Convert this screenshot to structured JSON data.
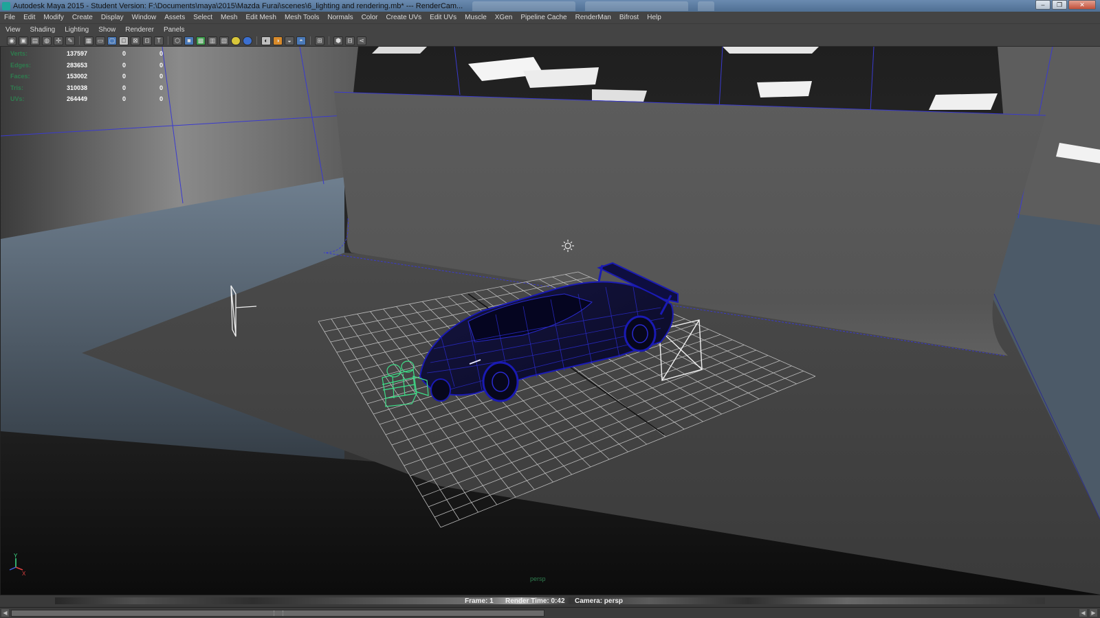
{
  "window": {
    "title": "Autodesk Maya 2015 - Student Version: F:\\Documents\\maya\\2015\\Mazda Furai\\scenes\\6_lighting and rendering.mb*   ---   RenderCam...",
    "controls": [
      "–",
      "❐",
      "✕"
    ]
  },
  "menubar": {
    "items": [
      "File",
      "Edit",
      "Modify",
      "Create",
      "Display",
      "Window",
      "Assets",
      "Select",
      "Mesh",
      "Edit Mesh",
      "Mesh Tools",
      "Normals",
      "Color",
      "Create UVs",
      "Edit UVs",
      "Muscle",
      "XGen",
      "Pipeline Cache",
      "RenderMan",
      "Bifrost",
      "Help"
    ]
  },
  "panel_menu": {
    "items": [
      "View",
      "Shading",
      "Lighting",
      "Show",
      "Renderer",
      "Panels"
    ]
  },
  "hud": {
    "rows": [
      {
        "label": "Verts:",
        "total": "137597",
        "selected": "0",
        "component": "0"
      },
      {
        "label": "Edges:",
        "total": "283653",
        "selected": "0",
        "component": "0"
      },
      {
        "label": "Faces:",
        "total": "153002",
        "selected": "0",
        "component": "0"
      },
      {
        "label": "Tris:",
        "total": "310038",
        "selected": "0",
        "component": "0"
      },
      {
        "label": "UVs:",
        "total": "264449",
        "selected": "0",
        "component": "0"
      }
    ]
  },
  "viewport": {
    "camera_label": "persp",
    "axis_labels": {
      "y": "Y",
      "x": "X"
    }
  },
  "status": {
    "frame": "Frame: 1",
    "render_time": "Render Time: 0:42",
    "camera": "Camera: persp"
  },
  "colors": {
    "wireframe": "#1a1ab4",
    "camera_wire": "#3fe08a",
    "hud_label": "#2f7d4f",
    "backdrop": "#595959"
  }
}
